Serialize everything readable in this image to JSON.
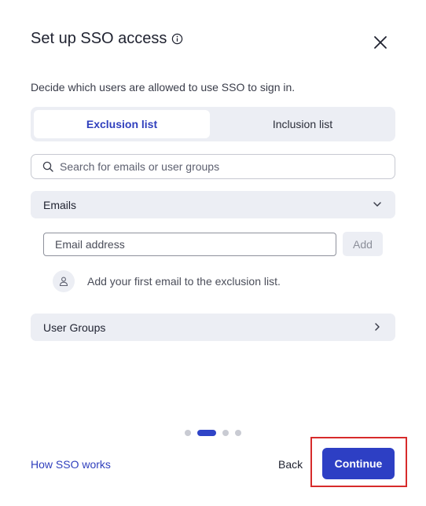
{
  "dialog": {
    "title": "Set up SSO access",
    "description": "Decide which users are allowed to use SSO to sign in."
  },
  "tabs": [
    {
      "label": "Exclusion list",
      "active": true
    },
    {
      "label": "Inclusion list",
      "active": false
    }
  ],
  "search": {
    "placeholder": "Search for emails or user groups"
  },
  "sections": {
    "emails": {
      "label": "Emails",
      "expanded": true
    },
    "user_groups": {
      "label": "User Groups",
      "expanded": false
    }
  },
  "email_form": {
    "placeholder": "Email address",
    "add_label": "Add",
    "empty_message": "Add your first email to the exclusion list."
  },
  "stepper": {
    "total": 4,
    "current": 2
  },
  "footer": {
    "help_link": "How SSO works",
    "back_label": "Back",
    "continue_label": "Continue"
  },
  "colors": {
    "accent": "#2d3fc4",
    "highlight": "#d72b2b",
    "surface": "#eceef4"
  },
  "icons": {
    "info": "info-icon",
    "close": "close-icon",
    "search": "search-icon",
    "expand": "chevron-down-icon",
    "collapsed": "chevron-right-icon",
    "user": "user-icon"
  }
}
